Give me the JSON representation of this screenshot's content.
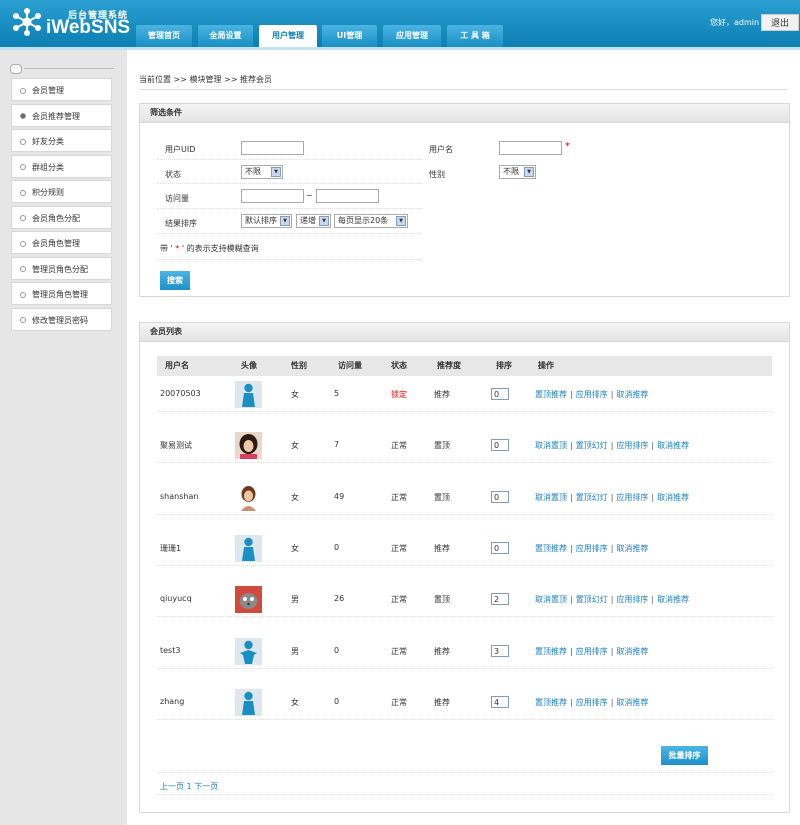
{
  "header": {
    "brand_top": "后台管理系统",
    "brand_main": "iWebSNS",
    "greeting": "您好，admin",
    "logout": "退出"
  },
  "nav": [
    {
      "label": "管理首页"
    },
    {
      "label": "全局设置"
    },
    {
      "label": "用户管理",
      "active": true
    },
    {
      "label": "UI管理"
    },
    {
      "label": "应用管理"
    },
    {
      "label": "工 具 箱"
    }
  ],
  "sidebar": [
    {
      "label": "会员管理"
    },
    {
      "label": "会员推荐管理",
      "active": true
    },
    {
      "label": "好友分类"
    },
    {
      "label": "群组分类"
    },
    {
      "label": "积分规则"
    },
    {
      "label": "会员角色分配"
    },
    {
      "label": "会员角色管理"
    },
    {
      "label": "管理员角色分配"
    },
    {
      "label": "管理员角色管理"
    },
    {
      "label": "修改管理员密码"
    }
  ],
  "breadcrumb": "当前位置 >> 模块管理 >> 推荐会员",
  "filter": {
    "title": "筛选条件",
    "uid_label": "用户UID",
    "username_label": "用户名",
    "required_mark": "*",
    "status_label": "状态",
    "status_value": "不限",
    "gender_label": "性别",
    "gender_value": "不限",
    "visits_label": "访问量",
    "range_sep": "~",
    "sort_label": "结果排序",
    "sort_field": "默认排序",
    "sort_dir": "递增",
    "page_size": "每页显示20条",
    "hint_pre": "带 ' ",
    "hint_star": "*",
    "hint_post": " ' 的表示支持模糊查询",
    "search_button": "搜索"
  },
  "list": {
    "title": "会员列表",
    "columns": [
      "用户名",
      "头像",
      "性别",
      "访问量",
      "状态",
      "推荐度",
      "排序",
      "操作"
    ],
    "rows": [
      {
        "username": "20070503",
        "avatar": "silhouette",
        "gender": "女",
        "visits": "5",
        "status": "锁定",
        "status_color": "#e00000",
        "rec": "推荐",
        "order": "0",
        "ops": [
          "置顶推荐",
          "应用排序",
          "取消推荐"
        ]
      },
      {
        "username": "聚易测试",
        "avatar": "photo-girl",
        "gender": "女",
        "visits": "7",
        "status": "正常",
        "status_color": "#333333",
        "rec": "置顶",
        "order": "0",
        "ops": [
          "取消置顶",
          "置顶幻灯",
          "应用排序",
          "取消推荐"
        ]
      },
      {
        "username": "shanshan",
        "avatar": "photo-woman",
        "gender": "女",
        "visits": "49",
        "status": "正常",
        "status_color": "#333333",
        "rec": "置顶",
        "order": "0",
        "ops": [
          "取消置顶",
          "置顶幻灯",
          "应用排序",
          "取消推荐"
        ]
      },
      {
        "username": "珊珊1",
        "avatar": "silhouette",
        "gender": "女",
        "visits": "0",
        "status": "正常",
        "status_color": "#333333",
        "rec": "推荐",
        "order": "0",
        "ops": [
          "置顶推荐",
          "应用排序",
          "取消推荐"
        ]
      },
      {
        "username": "qiuyucq",
        "avatar": "photo-cat",
        "gender": "男",
        "visits": "26",
        "status": "正常",
        "status_color": "#333333",
        "rec": "置顶",
        "order": "2",
        "ops": [
          "取消置顶",
          "置顶幻灯",
          "应用排序",
          "取消推荐"
        ]
      },
      {
        "username": "test3",
        "avatar": "silhouette-male",
        "gender": "男",
        "visits": "0",
        "status": "正常",
        "status_color": "#333333",
        "rec": "推荐",
        "order": "3",
        "ops": [
          "置顶推荐",
          "应用排序",
          "取消推荐"
        ]
      },
      {
        "username": "zhang",
        "avatar": "silhouette",
        "gender": "女",
        "visits": "0",
        "status": "正常",
        "status_color": "#333333",
        "rec": "推荐",
        "order": "4",
        "ops": [
          "置顶推荐",
          "应用排序",
          "取消推荐"
        ]
      }
    ],
    "batch_button": "批量排序",
    "prev": "上一页",
    "page": "1",
    "next": "下一页"
  }
}
